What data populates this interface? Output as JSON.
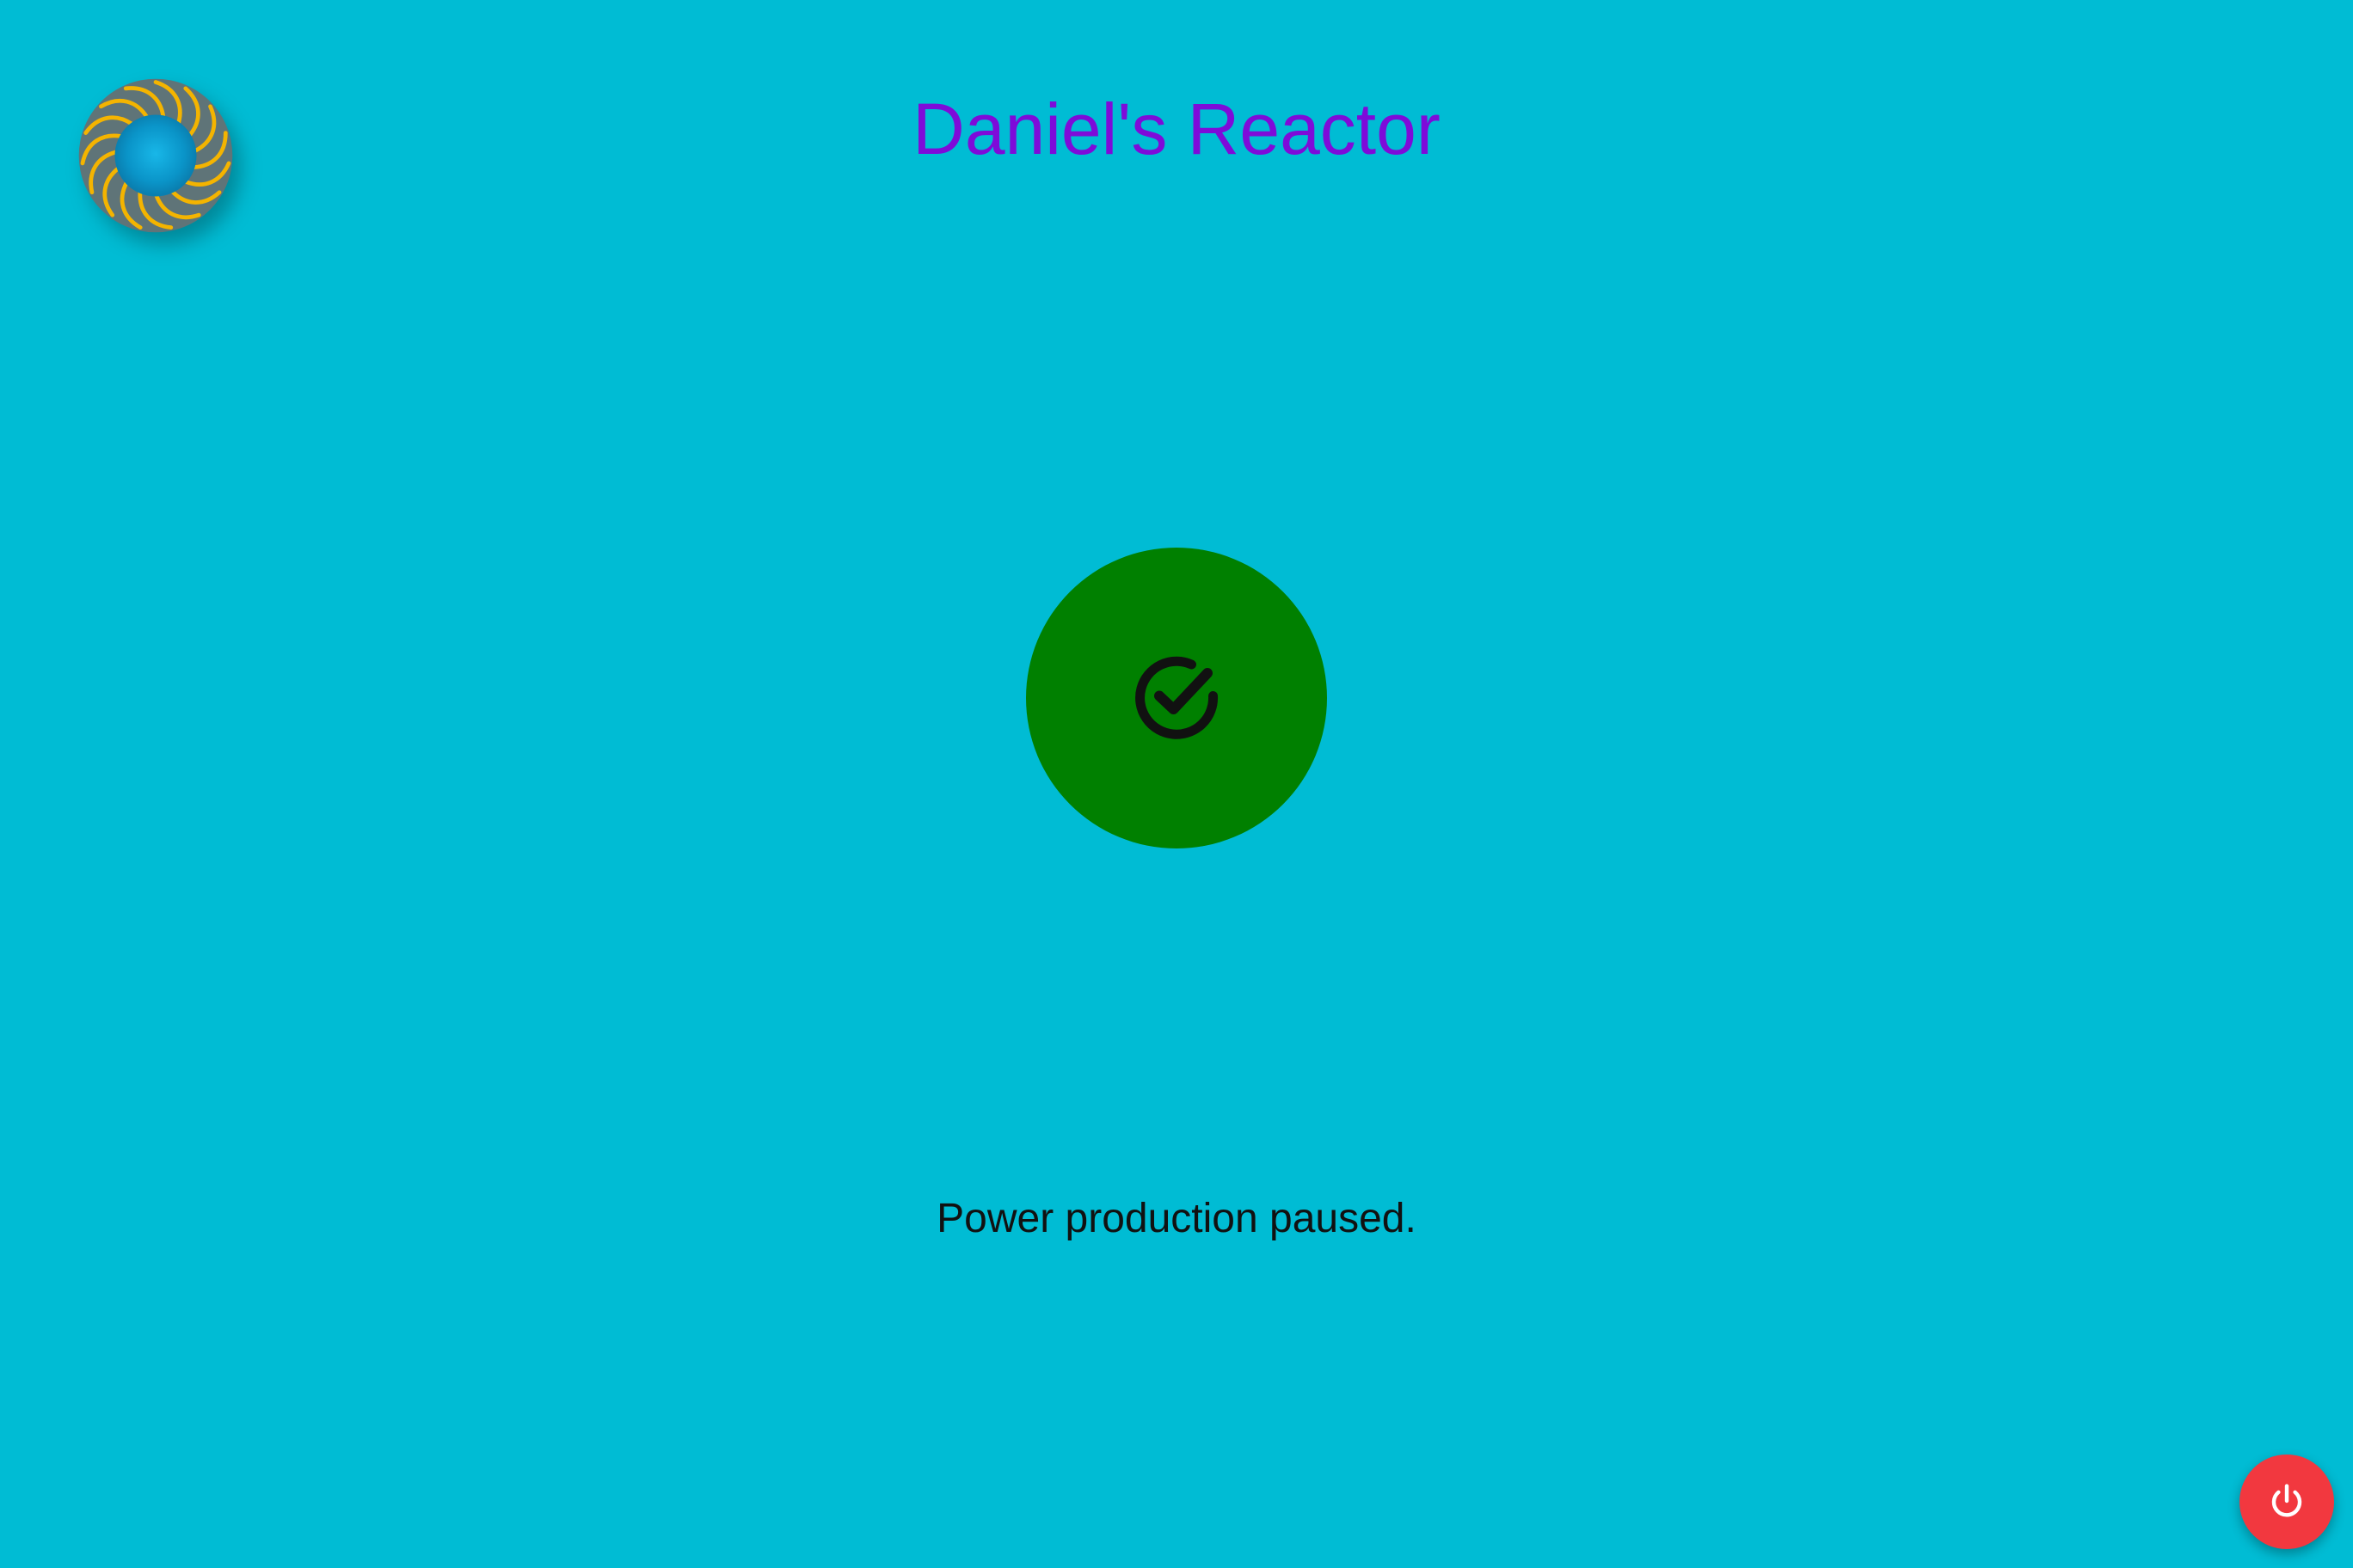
{
  "app": {
    "title": "Daniel's Reactor"
  },
  "status": {
    "message": "Power production paused.",
    "state_icon": "check-circle-icon",
    "color": "#008000"
  },
  "controls": {
    "power_icon": "power-icon",
    "power_color": "#f2383f"
  },
  "theme": {
    "background": "#00bcd4",
    "title_color": "#7e0bd9",
    "logo_icon": "reactor-logo-icon"
  }
}
